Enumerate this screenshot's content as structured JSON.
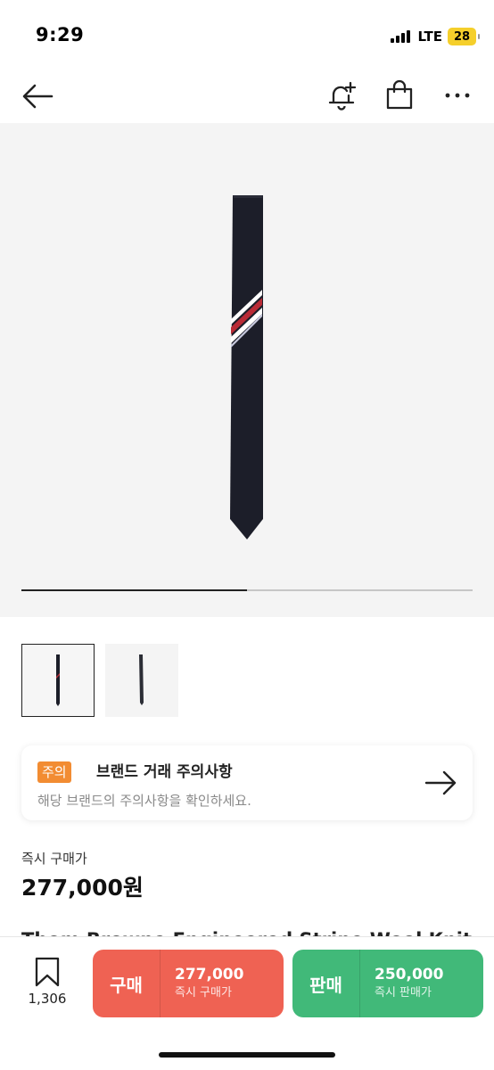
{
  "status_bar": {
    "time": "9:29",
    "network": "LTE",
    "battery": "28"
  },
  "nav": {
    "back_icon": "arrow-left-icon",
    "bell_icon": "bell-plus-icon",
    "bag_icon": "shopping-bag-icon",
    "more_icon": "more-horizontal-icon"
  },
  "gallery": {
    "image_count": 2,
    "current_index": 1,
    "progress_fraction": 0.5,
    "tie_color": "#1c1e29",
    "stripe_colors": [
      "#ffffff",
      "#b92b36",
      "#ffffff",
      "#c9cbe0"
    ]
  },
  "notice": {
    "badge": "주의",
    "title": "브랜드 거래 주의사항",
    "description": "해당 브랜드의 주의사항을 확인하세요.",
    "arrow_icon": "arrow-right-icon"
  },
  "price": {
    "label": "즉시 구매가",
    "value": "277,000원"
  },
  "title_peek": "Thom Browne Engineered Stripe Wool Knit Tie",
  "bottom_bar": {
    "wish_icon": "bookmark-icon",
    "wish_count": "1,306",
    "buy": {
      "label": "구매",
      "price": "277,000",
      "sub": "즉시 구매가",
      "color": "#ef6253"
    },
    "sell": {
      "label": "판매",
      "price": "250,000",
      "sub": "즉시 판매가",
      "color": "#41b979"
    }
  }
}
